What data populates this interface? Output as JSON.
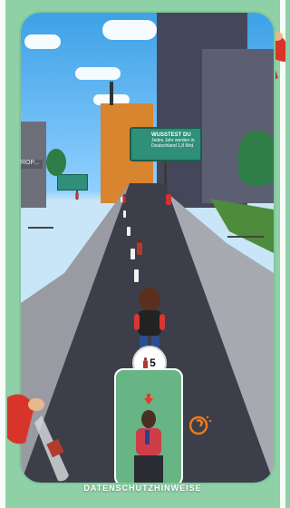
{
  "game": {
    "billboard": {
      "headline": "WUSSTEST DU",
      "body_line1": "Jedes Jahr werden in",
      "body_line2": "Deutschland 1,8 Mrd."
    },
    "side_sign_text": "ROP...",
    "bottle_counter": "5",
    "colors": {
      "frame_border": "#7fc79a",
      "hud_background": "#ffffff",
      "camera_panel": "#67b584",
      "accent_orange": "#f07a1a"
    },
    "icons": {
      "counter": "bottle-icon",
      "swipe": "swipe-gesture-icon",
      "camera_arrow": "down-arrow-icon"
    }
  },
  "footer": {
    "privacy_label": "DATENSCHUTZHINWEISE"
  }
}
